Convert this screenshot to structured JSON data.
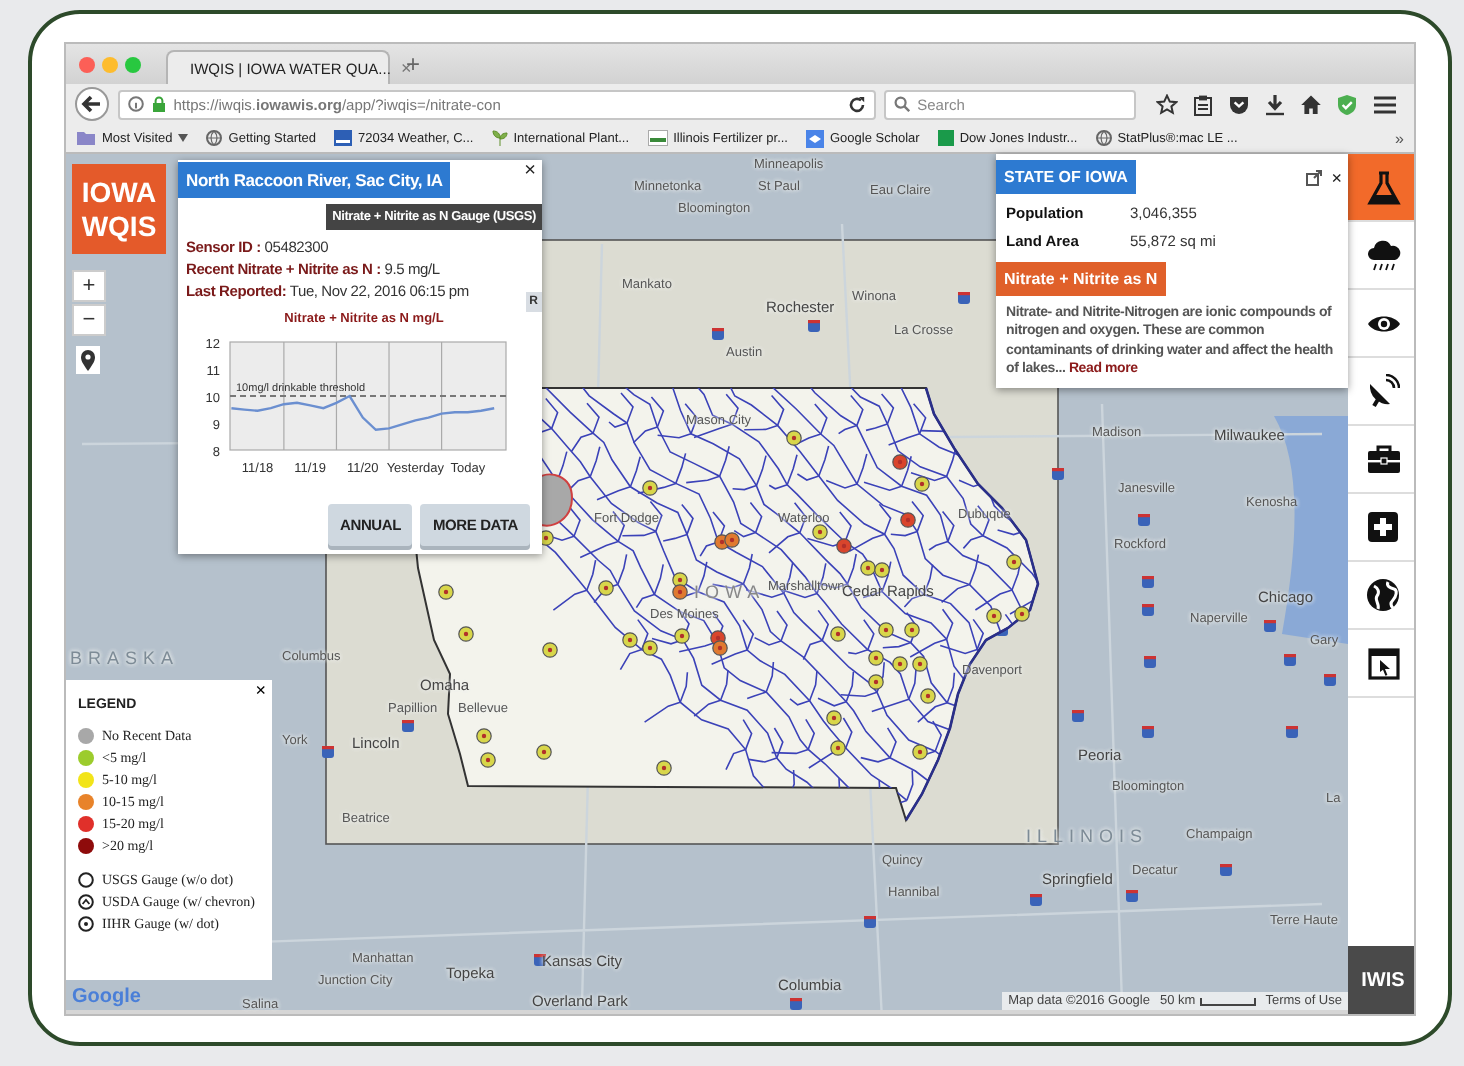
{
  "browser": {
    "tab_title": "IWQIS | IOWA WATER QUA...",
    "tab_close": "×",
    "new_tab": "+",
    "url": "https://iwqis.**iowawis.org**/app/?iwqis=/nitrate-con",
    "search_placeholder": "Search",
    "bookmarks": [
      {
        "kind": "folder",
        "label": "Most Visited"
      },
      {
        "kind": "globe",
        "label": "Getting Started"
      },
      {
        "kind": "weather",
        "label": "72034 Weather, C..."
      },
      {
        "kind": "plant",
        "label": "International Plant..."
      },
      {
        "kind": "fertilizer",
        "label": "Illinois Fertilizer pr..."
      },
      {
        "kind": "scholar",
        "label": "Google Scholar"
      },
      {
        "kind": "market",
        "label": "Dow Jones Industr..."
      },
      {
        "kind": "globe",
        "label": "StatPlus®:mac LE ..."
      }
    ],
    "overflow": "»"
  },
  "logo": {
    "line1": "IOWA",
    "line2": "WQIS"
  },
  "zoom": {
    "zoom_in": "+",
    "zoom_out": "−"
  },
  "gauge_popup": {
    "title": "North Raccoon River, Sac City, IA",
    "close": "×",
    "badge": "Nitrate + Nitrite as N Gauge (USGS)",
    "fields": [
      {
        "label": "Sensor ID :",
        "value": "05482300"
      },
      {
        "label": "Recent Nitrate + Nitrite as N :",
        "value": "9.5 mg/L"
      },
      {
        "label": "Last Reported:",
        "value": "Tue, Nov 22, 2016 06:15 pm"
      }
    ],
    "side_tab": "R",
    "chart_data": {
      "type": "line",
      "title": "Nitrate + Nitrite as N mg/L",
      "categories": [
        null,
        null,
        "11/18",
        null,
        null,
        null,
        "11/19",
        null,
        null,
        null,
        "11/20",
        null,
        null,
        null,
        "Yesterday",
        null,
        null,
        null,
        "Today",
        null,
        null
      ],
      "series": [
        {
          "color": "#6b8fd0",
          "values": [
            9.55,
            9.5,
            9.45,
            9.55,
            9.7,
            9.75,
            9.65,
            9.55,
            9.75,
            10.0,
            9.2,
            8.75,
            8.8,
            8.95,
            9.1,
            9.2,
            9.35,
            9.4,
            9.4,
            9.45,
            9.55
          ]
        }
      ],
      "ylim": [
        8,
        12
      ],
      "yticks": [
        8,
        9,
        10,
        11,
        12
      ],
      "grid": true,
      "ref_lines": [
        {
          "axis": "y",
          "value": 10,
          "label": "10mg/l drinkable threshold"
        }
      ]
    },
    "buttons": [
      "ANNUAL",
      "MORE DATA"
    ]
  },
  "state_panel": {
    "title": "STATE OF IOWA",
    "close": "×",
    "stats": [
      {
        "label": "Population",
        "value": "3,046,355"
      },
      {
        "label": "Land Area",
        "value": "55,872 sq mi"
      }
    ],
    "section_title": "Nitrate + Nitrite as N",
    "description": "Nitrate- and Nitrite-Nitrogen are ionic compounds of nitrogen and oxygen. These are common contaminants of drinking water and affect the health of lakes...",
    "link": "Read more"
  },
  "legend": {
    "title": "LEGEND",
    "close": "×",
    "levels": [
      {
        "label": "No Recent Data",
        "color": "#a8a8a8"
      },
      {
        "label": "<5 mg/l",
        "color": "#9ccc2c"
      },
      {
        "label": "5-10 mg/l",
        "color": "#f2e419"
      },
      {
        "label": "10-15 mg/l",
        "color": "#e8832a"
      },
      {
        "label": "15-20 mg/l",
        "color": "#e0302a"
      },
      {
        "label": ">20 mg/l",
        "color": "#8e0b0b"
      }
    ],
    "gauges": [
      {
        "kind": "plain",
        "label": "USGS Gauge (w/o dot)"
      },
      {
        "kind": "chevron",
        "label": "USDA Gauge (w/ chevron)"
      },
      {
        "kind": "dot",
        "label": "IIHR Gauge (w/ dot)"
      }
    ]
  },
  "map": {
    "labels": [
      "Minneapolis",
      "Minnetonka",
      "St Paul",
      "Eau Claire",
      "Bloomington",
      "Mankato",
      "Rochester",
      "Winona",
      "La Crosse",
      "Austin",
      "Mason City",
      "Fort Dodge",
      "Waterloo",
      "Dubuque",
      "IOWA",
      "Marshalltown",
      "Cedar Rapids",
      "Des Moines",
      "Davenport",
      "Columbus",
      "BRASKA",
      "Omaha",
      "Papillion",
      "Bellevue",
      "Lincoln",
      "York",
      "Beatrice",
      "Madison",
      "Milwaukee",
      "Janesville",
      "Kenosha",
      "Rockford",
      "Chicago",
      "Naperville",
      "Gary",
      "Peoria",
      "Bloomington",
      "ILLINOIS",
      "Champaign",
      "La",
      "Quincy",
      "Springfield",
      "Decatur",
      "Hannibal",
      "Terre Haute",
      "Manhattan",
      "Junction City",
      "Topeka",
      "Kansas City",
      "Overland Park",
      "Columbia",
      "Salina"
    ],
    "google": "Google",
    "attribution": "Map data ©2016 Google",
    "scale": "50 km",
    "terms": "Terms of Use"
  },
  "sidebar": {
    "items": [
      {
        "kind": "flask",
        "selected": true
      },
      {
        "kind": "rain",
        "selected": false
      },
      {
        "kind": "eye",
        "selected": false
      },
      {
        "kind": "dish",
        "selected": false
      },
      {
        "kind": "toolbox",
        "selected": false
      },
      {
        "kind": "aid",
        "selected": false
      },
      {
        "kind": "globe",
        "selected": false
      },
      {
        "kind": "window",
        "selected": false
      }
    ],
    "footer": "IWIS"
  }
}
